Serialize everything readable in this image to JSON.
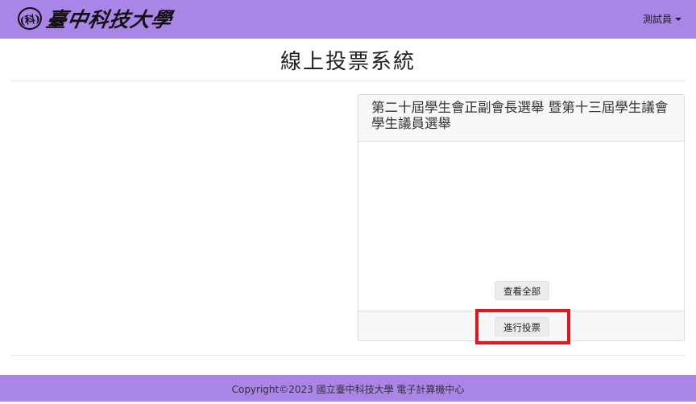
{
  "header": {
    "logo_seal": "(科)",
    "logo_text": "臺中科技大學",
    "user_label": "測試員"
  },
  "page": {
    "title": "線上投票系統"
  },
  "election_card": {
    "title": "第二十屆學生會正副會長選舉  暨第十三屆學生議會學生議員選舉",
    "view_all_label": "查看全部",
    "vote_label": "進行投票"
  },
  "footer": {
    "copyright": "Copyright©2023 國立臺中科技大學 電子計算機中心"
  },
  "colors": {
    "navbar": "#a985e8",
    "footer": "#a985e8",
    "highlight": "#e8141a"
  },
  "icons": {
    "user_menu": "caret-down-icon"
  }
}
